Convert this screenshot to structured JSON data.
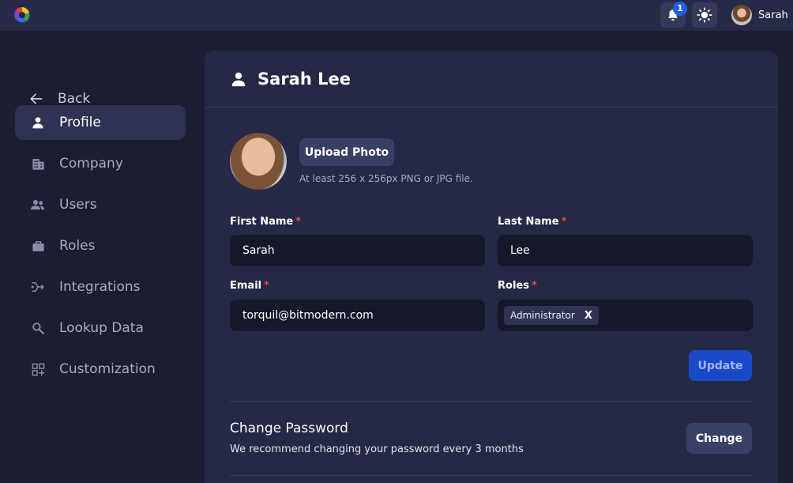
{
  "topbar": {
    "logo_icon": "app-logo-icon",
    "notifications_count": "1",
    "theme_icon": "sun-icon",
    "user_name": "Sarah"
  },
  "sidebar": {
    "back_label": "Back",
    "items": [
      {
        "label": "Profile",
        "icon": "user-icon",
        "active": true
      },
      {
        "label": "Company",
        "icon": "building-icon",
        "active": false
      },
      {
        "label": "Users",
        "icon": "users-icon",
        "active": false
      },
      {
        "label": "Roles",
        "icon": "briefcase-icon",
        "active": false
      },
      {
        "label": "Integrations",
        "icon": "integrations-icon",
        "active": false
      },
      {
        "label": "Lookup Data",
        "icon": "search-icon",
        "active": false
      },
      {
        "label": "Customization",
        "icon": "dashboard-icon",
        "active": false
      }
    ]
  },
  "profile": {
    "title": "Sarah Lee",
    "upload_label": "Upload Photo",
    "upload_hint": "At least 256 x 256px PNG or JPG file.",
    "first_name_label": "First Name",
    "first_name_value": "Sarah",
    "last_name_label": "Last Name",
    "last_name_value": "Lee",
    "email_label": "Email",
    "email_value": "torquil@bitmodern.com",
    "roles_label": "Roles",
    "roles": [
      "Administrator"
    ],
    "required_marker": "*",
    "update_label": "Update"
  },
  "password": {
    "title": "Change Password",
    "description": "We recommend changing your password every 3 months",
    "change_label": "Change"
  },
  "colors": {
    "background": "#1b1d33",
    "card": "#252945",
    "accent": "#1a49c8",
    "required": "#e64b4b"
  }
}
